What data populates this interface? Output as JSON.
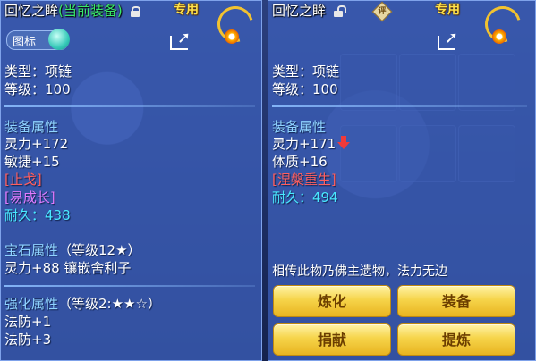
{
  "left": {
    "title_name": "回忆之眸",
    "title_current": "(当前装备)",
    "lock": "lock-icon",
    "tag": "专用",
    "toggle_label": "图标",
    "type": "类型：项链",
    "level": "等级：100",
    "attr_header": "装备属性",
    "attrs": [
      "灵力+172",
      "敏捷+15"
    ],
    "special1": "[止戈]",
    "special2": "[易成长]",
    "durability": "耐久：438",
    "gem_header_main": "宝石属性",
    "gem_header_sub": "（等级12★）",
    "gem_line": "灵力+88 镶嵌舍利子",
    "enh_header_main": "强化属性",
    "enh_header_sub": "（等级2:★★☆）",
    "enh_lines": [
      "法防+1",
      "法防+3"
    ]
  },
  "right": {
    "title_name": "回忆之眸",
    "lock": "unlock-icon",
    "badge": "评",
    "tag": "专用",
    "type": "类型：项链",
    "level": "等级：100",
    "attr_header": "装备属性",
    "attrs": [
      "灵力+171",
      "体质+16"
    ],
    "attr_down_icon": "down-arrow-icon",
    "special1": "[涅槃重生]",
    "durability": "耐久：494",
    "description": "相传此物乃佛主遗物，法力无边",
    "buttons": {
      "refine": "炼化",
      "equip": "装备",
      "donate": "捐献",
      "extract": "提炼"
    }
  },
  "colors": {
    "panel": "#3c5fb9",
    "header": "#8fd3ff",
    "red": "#ff5f5f",
    "purple": "#e07bff",
    "cyan": "#49e9ff",
    "button": "#f6d44a"
  }
}
